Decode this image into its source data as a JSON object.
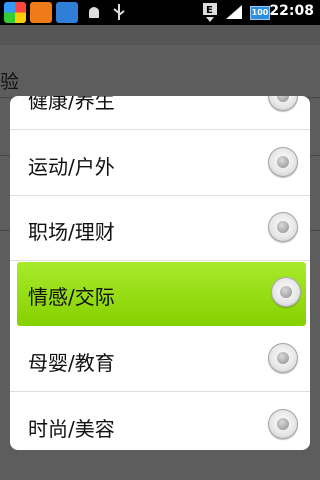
{
  "status_bar": {
    "time": "22:08",
    "battery": "100",
    "icons": [
      "colorful-app-icon",
      "orange-app-icon",
      "mail-app-icon",
      "android-debug-icon",
      "usb-icon",
      "data-e-icon",
      "signal-icon",
      "battery-icon"
    ]
  },
  "background": {
    "title": "验"
  },
  "dialog": {
    "items": [
      {
        "label": "健康/养生",
        "selected": false
      },
      {
        "label": "运动/户外",
        "selected": false
      },
      {
        "label": "职场/理财",
        "selected": false
      },
      {
        "label": "情感/交际",
        "selected": true
      },
      {
        "label": "母婴/教育",
        "selected": false
      },
      {
        "label": "时尚/美容",
        "selected": false
      }
    ]
  },
  "colors": {
    "selected_bg": "#9ad91a",
    "dialog_bg": "#ffffff"
  }
}
